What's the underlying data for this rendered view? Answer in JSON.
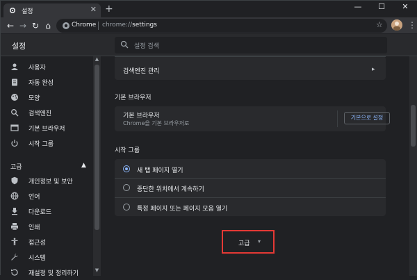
{
  "browser": {
    "tab_title": "설정",
    "tab_close": "✕",
    "new_tab": "+",
    "window_controls": {
      "minimize": "—",
      "maximize": "☐",
      "close": "✕"
    },
    "omnibox": {
      "site": "Chrome",
      "url_scheme": "chrome://",
      "url_path": "settings"
    }
  },
  "header": {
    "title": "설정",
    "search_placeholder": "설정 검색"
  },
  "sidebar": {
    "items": [
      {
        "label": "사용자",
        "icon": "person-icon"
      },
      {
        "label": "자동 완성",
        "icon": "clipboard-icon"
      },
      {
        "label": "모양",
        "icon": "palette-icon"
      },
      {
        "label": "검색엔진",
        "icon": "search-icon"
      },
      {
        "label": "기본 브라우저",
        "icon": "browser-icon"
      },
      {
        "label": "시작 그룹",
        "icon": "power-icon"
      }
    ],
    "advanced_section": "고급",
    "advanced_caret": "▲",
    "advanced_items": [
      {
        "label": "개인정보 및 보안",
        "icon": "shield-icon"
      },
      {
        "label": "언어",
        "icon": "globe-icon"
      },
      {
        "label": "다운로드",
        "icon": "download-icon"
      },
      {
        "label": "인쇄",
        "icon": "printer-icon"
      },
      {
        "label": "접근성",
        "icon": "accessibility-icon"
      },
      {
        "label": "시스템",
        "icon": "wrench-icon"
      },
      {
        "label": "재설정 및 정리하기",
        "icon": "reset-icon"
      }
    ]
  },
  "main": {
    "search_engine_manage": "검색엔진 관리",
    "default_browser": {
      "section_title": "기본 브라우저",
      "row_title": "기본 브라우저",
      "row_sub": "Chrome을 기본 브라우저로",
      "button": "기본으로 설정"
    },
    "startup": {
      "section_title": "시작 그룹",
      "options": [
        {
          "label": "새 탭 페이지 열기",
          "selected": true
        },
        {
          "label": "중단한 위치에서 계속하기",
          "selected": false
        },
        {
          "label": "특정 페이지 또는 페이지 모음 열기",
          "selected": false
        }
      ]
    },
    "advanced_button": "고급",
    "advanced_caret": "▾"
  },
  "colors": {
    "accent": "#8ab4f8",
    "highlight_box": "#e53935",
    "background": "#202124",
    "card": "#292a2d"
  }
}
